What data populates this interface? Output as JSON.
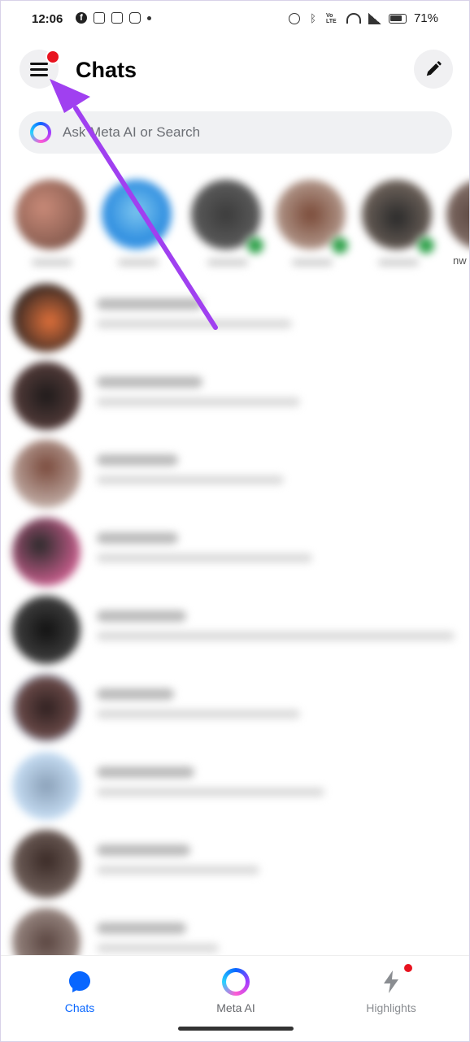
{
  "status_bar": {
    "time": "12:06",
    "battery": "71%",
    "notification_icons": [
      "facebook-icon",
      "grid-app-icon",
      "grid-app-icon",
      "instagram-icon",
      "dot-icon"
    ],
    "system_icons": [
      "alarm-icon",
      "bluetooth-icon",
      "volte-icon",
      "wifi-icon",
      "signal-icon",
      "battery-icon"
    ]
  },
  "header": {
    "title": "Chats",
    "menu_has_badge": true
  },
  "search": {
    "placeholder": "Ask Meta AI or Search"
  },
  "stories": {
    "count": 6,
    "partial_label": "nw"
  },
  "chat_list": {
    "rows": 9
  },
  "bottom_nav": {
    "items": [
      {
        "label": "Chats",
        "icon": "chat-bubble-icon",
        "active": true
      },
      {
        "label": "Meta AI",
        "icon": "meta-ai-ring-icon",
        "active": false
      },
      {
        "label": "Highlights",
        "icon": "lightning-icon",
        "active": false,
        "badge": true
      }
    ]
  },
  "colors": {
    "accent": "#0866ff",
    "badge": "#e8131f",
    "annotation_arrow": "#a040f0",
    "search_bg": "#f0f1f3"
  }
}
